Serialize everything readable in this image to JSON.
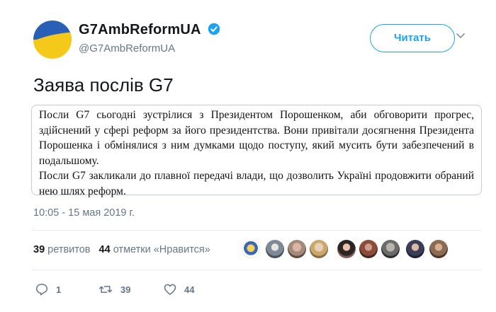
{
  "account": {
    "display_name": "G7AmbReformUA",
    "handle": "@G7AmbReformUA",
    "verified": true,
    "avatar_colors": {
      "top": "#2a5fb8",
      "bottom": "#f5c91a"
    }
  },
  "follow_button": {
    "label": "Читать"
  },
  "tweet": {
    "title": "Заява послів G7",
    "statement_paragraphs": [
      "Посли G7 сьогодні зустрілися з Президентом Порошенком, аби обговорити прогрес, здійснений у сфері реформ за його президентства. Вони привітали досягнення Президента Порошенка і обмінялися з ним думками щодо поступу, який мусить бути забезпечений в подальшому.",
      "Посли G7 закликали до плавної передачі влади, що дозволить Україні продовжити обраний нею шлях реформ."
    ],
    "timestamp": "10:05 - 15 мая 2019 г."
  },
  "stats": {
    "retweets_count": "39",
    "retweets_label": "ретвитов",
    "likes_count": "44",
    "likes_label": "отметки «Нравится»"
  },
  "action_bar": {
    "reply_count": "1",
    "retweet_count": "39",
    "like_count": "44"
  },
  "colors": {
    "accent": "#1da1f2",
    "secondary_text": "#657786",
    "primary_text": "#14171a"
  }
}
